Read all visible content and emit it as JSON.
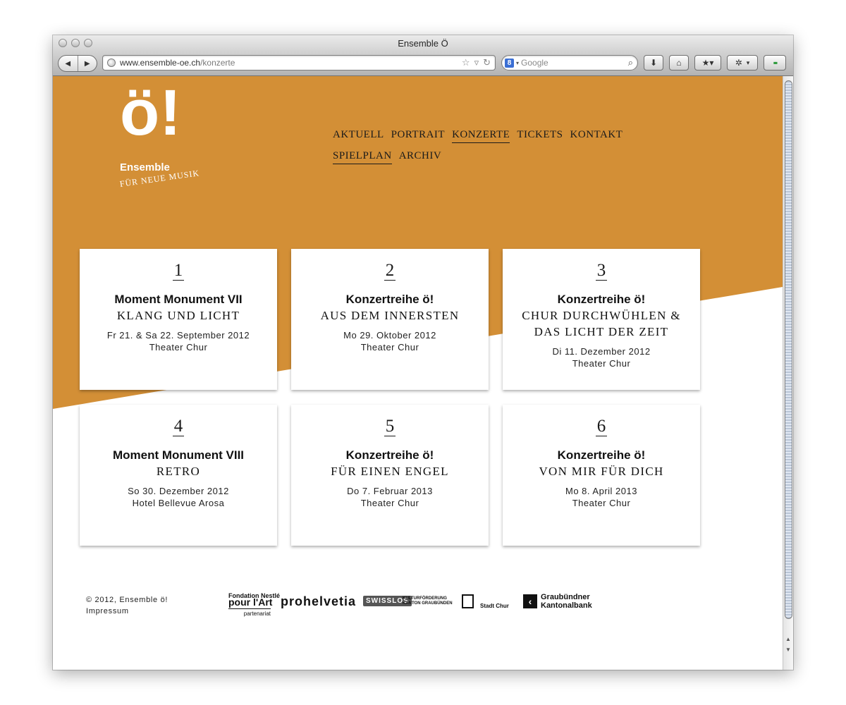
{
  "window": {
    "title": "Ensemble Ö"
  },
  "toolbar": {
    "back_icon": "◀",
    "forward_icon": "▶",
    "url_host": "www.ensemble-oe.ch",
    "url_path": "/konzerte",
    "search_engine_badge": "8",
    "search_placeholder": "Google",
    "download_icon": "⬇",
    "home_icon": "⌂",
    "bookmark_icon": "★▾",
    "extension_icon": "✲",
    "extension_caret": "▾",
    "addon_icon": "▪▪"
  },
  "site": {
    "logo": {
      "mark": "ö!",
      "name": "Ensemble",
      "subtitle": "FÜR NEUE MUSIK"
    },
    "nav": {
      "primary": [
        {
          "label": "AKTUELL",
          "active": false
        },
        {
          "label": "PORTRAIT",
          "active": false
        },
        {
          "label": "KONZERTE",
          "active": true
        },
        {
          "label": "TICKETS",
          "active": false
        },
        {
          "label": "KONTAKT",
          "active": false
        }
      ],
      "secondary": [
        {
          "label": "SPIELPLAN",
          "active": true
        },
        {
          "label": "ARCHIV",
          "active": false
        }
      ]
    },
    "concerts": [
      {
        "number": "1",
        "title": "Moment Monument VII",
        "subtitle_lines": [
          "KLANG UND LICHT"
        ],
        "date": "Fr 21. & Sa 22. September 2012",
        "venue": "Theater Chur"
      },
      {
        "number": "2",
        "title": "Konzertreihe ö!",
        "subtitle_lines": [
          "AUS DEM INNERSTEN"
        ],
        "date": "Mo 29. Oktober 2012",
        "venue": "Theater Chur"
      },
      {
        "number": "3",
        "title": "Konzertreihe ö!",
        "subtitle_lines": [
          "CHUR DURCHWÜHLEN &",
          "DAS LICHT DER ZEIT"
        ],
        "date": "Di 11. Dezember 2012",
        "venue": "Theater Chur"
      },
      {
        "number": "4",
        "title": "Moment Monument VIII",
        "subtitle_lines": [
          "RETRO"
        ],
        "date": "So 30. Dezember 2012",
        "venue": "Hotel Bellevue Arosa"
      },
      {
        "number": "5",
        "title": "Konzertreihe ö!",
        "subtitle_lines": [
          "FÜR EINEN ENGEL"
        ],
        "date": "Do 7. Februar 2013",
        "venue": "Theater Chur"
      },
      {
        "number": "6",
        "title": "Konzertreihe ö!",
        "subtitle_lines": [
          "VON MIR FÜR DICH"
        ],
        "date": "Mo 8. April 2013",
        "venue": "Theater Chur"
      }
    ],
    "footer": {
      "copyright": "© 2012, Ensemble ö!",
      "impressum": "Impressum",
      "sponsors": {
        "nestle_line1": "Fondation Nestlé",
        "nestle_line2": "pour l'Art",
        "nestle_tag": "partenariat",
        "prohelvetia": "prohelvetia",
        "swisslos": "SWISSLOS",
        "kultur_line1": "KULTURFÖRDERUNG",
        "kultur_line2": "KANTON GRAUBÜNDEN",
        "chur": "Stadt Chur",
        "gkb_line1": "Graubündner",
        "gkb_line2": "Kantonalbank"
      }
    }
  },
  "colors": {
    "brand_orange": "#d38f36",
    "text": "#1a1a1a"
  }
}
